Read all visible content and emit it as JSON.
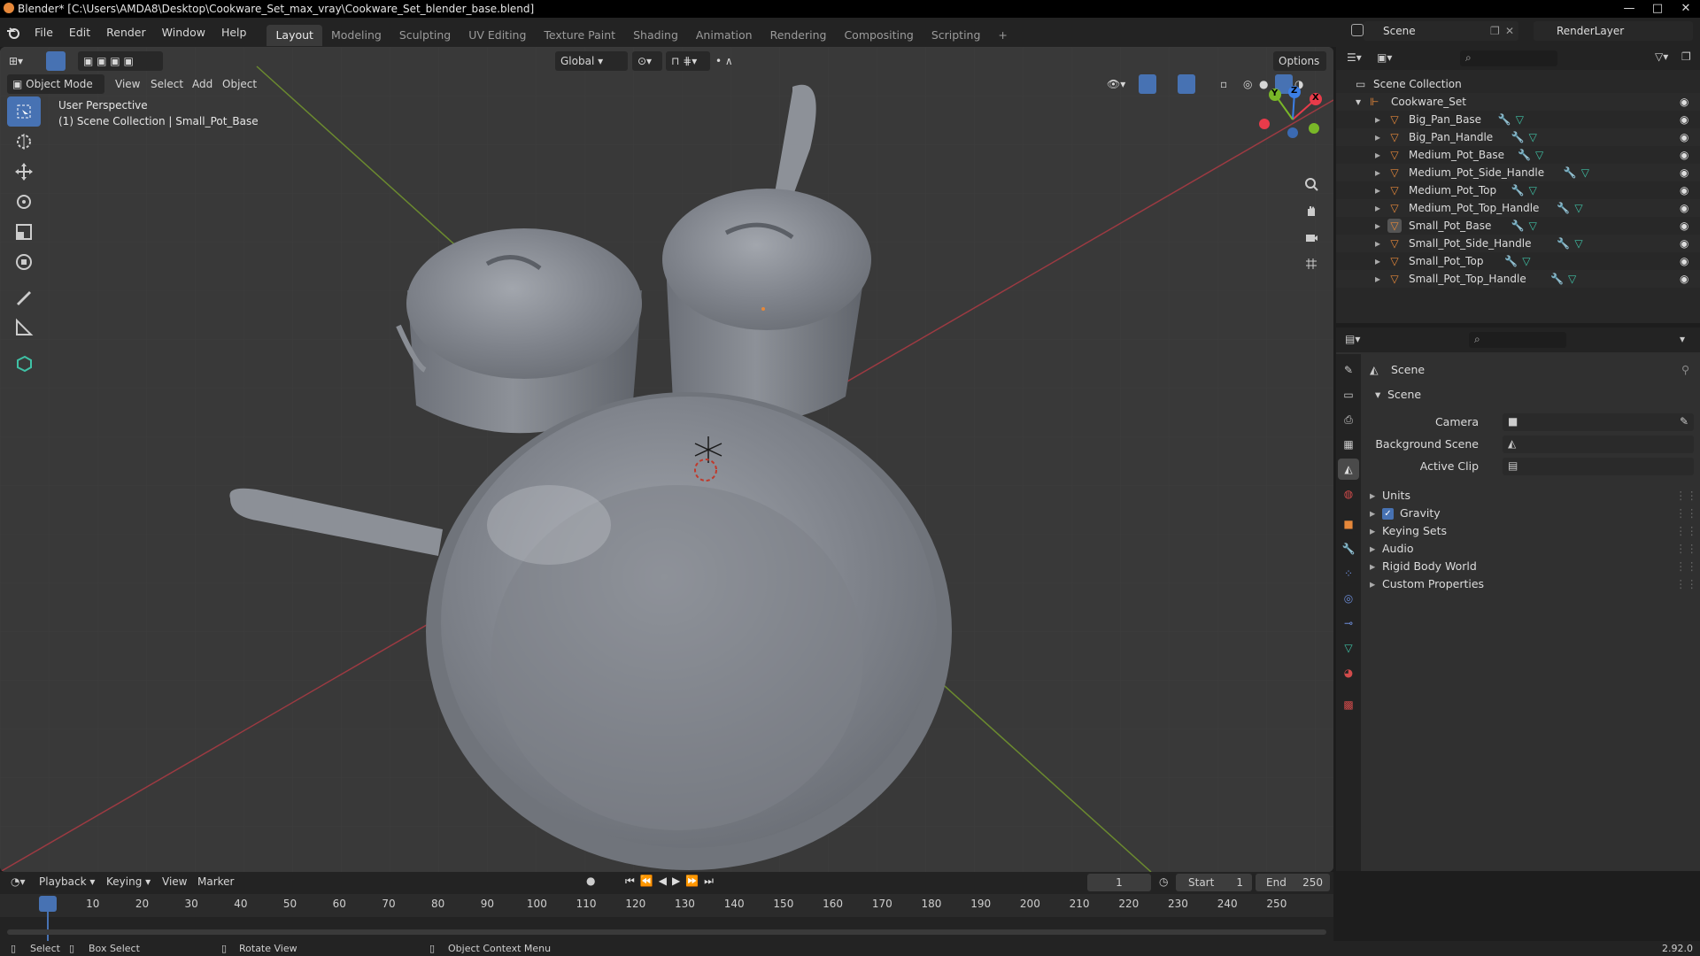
{
  "window": {
    "title": "Blender* [C:\\Users\\AMDA8\\Desktop\\Cookware_Set_max_vray\\Cookware_Set_blender_base.blend]",
    "controls": [
      "—",
      "□",
      "✕"
    ]
  },
  "menu": [
    "File",
    "Edit",
    "Render",
    "Window",
    "Help"
  ],
  "workspaces": [
    "Layout",
    "Modeling",
    "Sculpting",
    "UV Editing",
    "Texture Paint",
    "Shading",
    "Animation",
    "Rendering",
    "Compositing",
    "Scripting"
  ],
  "add_workspace": "+",
  "scene_name": "Scene",
  "view_layer": "RenderLayer",
  "viewport": {
    "mode": "Object Mode",
    "menus": [
      "View",
      "Select",
      "Add",
      "Object"
    ],
    "transform": "Global",
    "options": "Options",
    "info_line1": "User Perspective",
    "info_line2": "(1) Scene Collection | Small_Pot_Base",
    "gizmo": {
      "x": "X",
      "y": "Y",
      "z": "Z"
    }
  },
  "outliner": {
    "root": "Scene Collection",
    "collection": "Cookware_Set",
    "objects": [
      "Big_Pan_Base",
      "Big_Pan_Handle",
      "Medium_Pot_Base",
      "Medium_Pot_Side_Handle",
      "Medium_Pot_Top",
      "Medium_Pot_Top_Handle",
      "Small_Pot_Base",
      "Small_Pot_Side_Handle",
      "Small_Pot_Top",
      "Small_Pot_Top_Handle"
    ],
    "active": "Small_Pot_Base"
  },
  "properties": {
    "context": "Scene",
    "panel": "Scene",
    "fields": [
      {
        "label": "Camera",
        "value": ""
      },
      {
        "label": "Background Scene",
        "value": ""
      },
      {
        "label": "Active Clip",
        "value": ""
      }
    ],
    "subpanels": [
      "Units",
      "Gravity",
      "Keying Sets",
      "Audio",
      "Rigid Body World",
      "Custom Properties"
    ],
    "gravity_checked": true
  },
  "timeline": {
    "menus": [
      "Playback",
      "Keying",
      "View",
      "Marker"
    ],
    "current_frame": "1",
    "start_label": "Start",
    "start": "1",
    "end_label": "End",
    "end": "250",
    "ticks": [
      "1",
      "10",
      "20",
      "30",
      "40",
      "50",
      "60",
      "70",
      "80",
      "90",
      "100",
      "110",
      "120",
      "130",
      "140",
      "150",
      "160",
      "170",
      "180",
      "190",
      "200",
      "210",
      "220",
      "230",
      "240",
      "250"
    ]
  },
  "status": {
    "select": "Select",
    "box_select": "Box Select",
    "rotate": "Rotate View",
    "context_menu": "Object Context Menu",
    "version": "2.92.0"
  },
  "colors": {
    "accent": "#4772b3",
    "object_icon": "#e6883a",
    "mesh_icon": "#3fc1a5",
    "modifier_icon": "#6b8bd6",
    "axis_x": "#e83b4a",
    "axis_y": "#79b728",
    "axis_z": "#3c7fe6"
  }
}
